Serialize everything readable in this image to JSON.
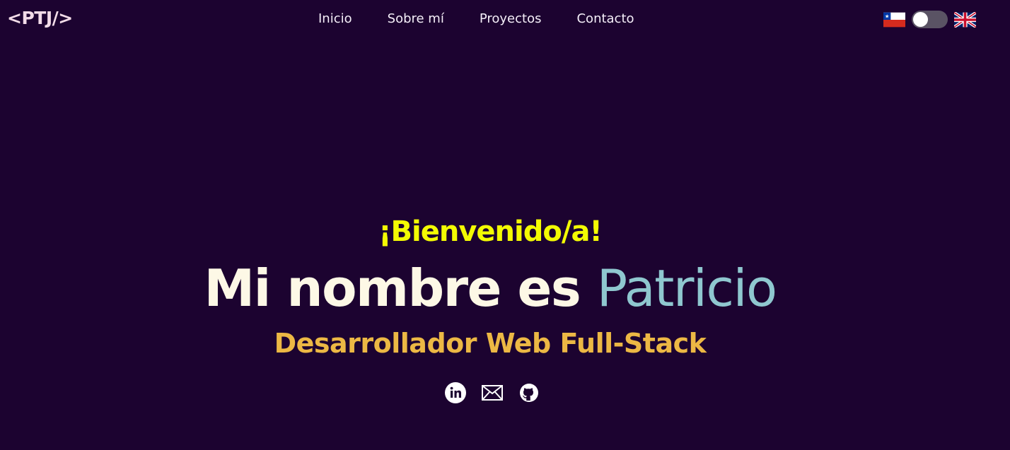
{
  "header": {
    "logo": "<PTJ/>",
    "nav": [
      {
        "label": "Inicio"
      },
      {
        "label": "Sobre mí"
      },
      {
        "label": "Proyectos"
      },
      {
        "label": "Contacto"
      }
    ],
    "language_switch": {
      "left_flag": "chile-flag-icon",
      "right_flag": "uk-flag-icon",
      "toggle_state": "off"
    }
  },
  "hero": {
    "greeting": "¡Bienvenido/a!",
    "name_prefix": "Mi nombre es ",
    "name": "Patricio",
    "role": "Desarrollador Web Full-Stack",
    "socials": [
      {
        "icon": "linkedin-icon"
      },
      {
        "icon": "mail-icon"
      },
      {
        "icon": "github-icon"
      }
    ]
  },
  "colors": {
    "background": "#1c0330",
    "greeting": "#f3fb03",
    "name_text": "#fdf8e6",
    "name_highlight": "#8fc7cf",
    "role": "#ecb844",
    "nav_text": "#f4eef8",
    "logo": "#f2dce8"
  }
}
